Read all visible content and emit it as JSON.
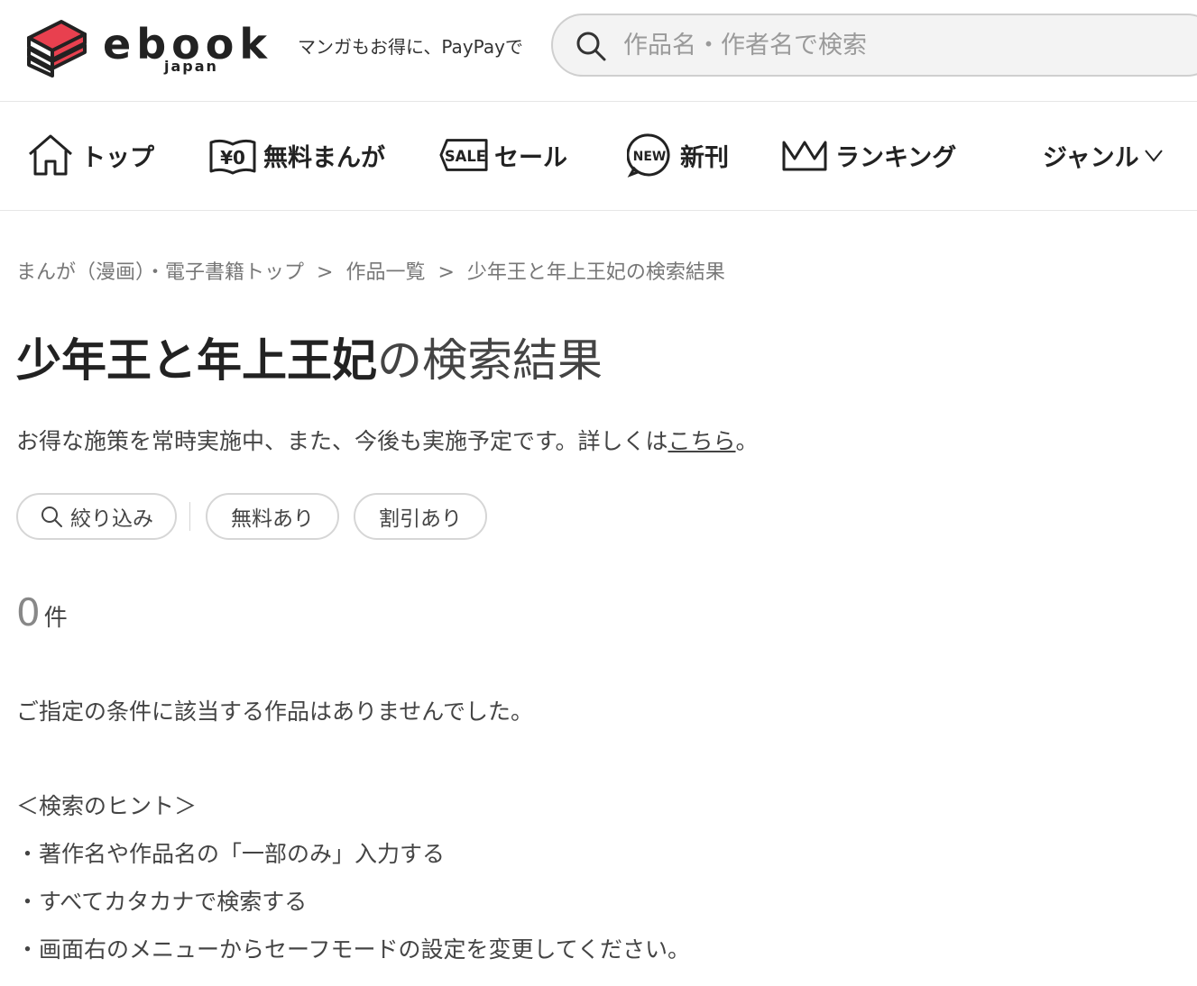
{
  "header": {
    "logo_word": "ebook",
    "logo_sub": "japan",
    "tagline": "マンガもお得に、PayPayで",
    "search_placeholder": "作品名・作者名で検索"
  },
  "nav": {
    "top": "トップ",
    "free": "無料まんが",
    "sale": "セール",
    "new": "新刊",
    "ranking": "ランキング",
    "genre": "ジャンル"
  },
  "icons": {
    "sale_text": "SALE",
    "new_text": "NEW",
    "free_text": "¥0"
  },
  "breadcrumb": {
    "items": [
      "まんが（漫画）・電子書籍トップ",
      "作品一覧",
      "少年王と年上王妃の検索結果"
    ],
    "separator": ">"
  },
  "result": {
    "keyword": "少年王と年上王妃",
    "title_suffix": "の検索結果",
    "notice_text": "お得な施策を常時実施中、また、今後も実施予定です。詳しくは",
    "notice_link": "こちら",
    "notice_end": "。",
    "count": "0",
    "count_unit": "件",
    "empty_message": "ご指定の条件に該当する作品はありませんでした。"
  },
  "filters": {
    "narrow": "絞り込み",
    "free": "無料あり",
    "discount": "割引あり"
  },
  "hints": {
    "heading": "＜検索のヒント＞",
    "items": [
      "・著作名や作品名の「一部のみ」入力する",
      "・すべてカタカナで検索する",
      "・画面右のメニューからセーフモードの設定を変更してください。"
    ]
  },
  "colors": {
    "brand_red": "#e8404f",
    "text_dark": "#222222",
    "border": "#d6d6d6"
  }
}
